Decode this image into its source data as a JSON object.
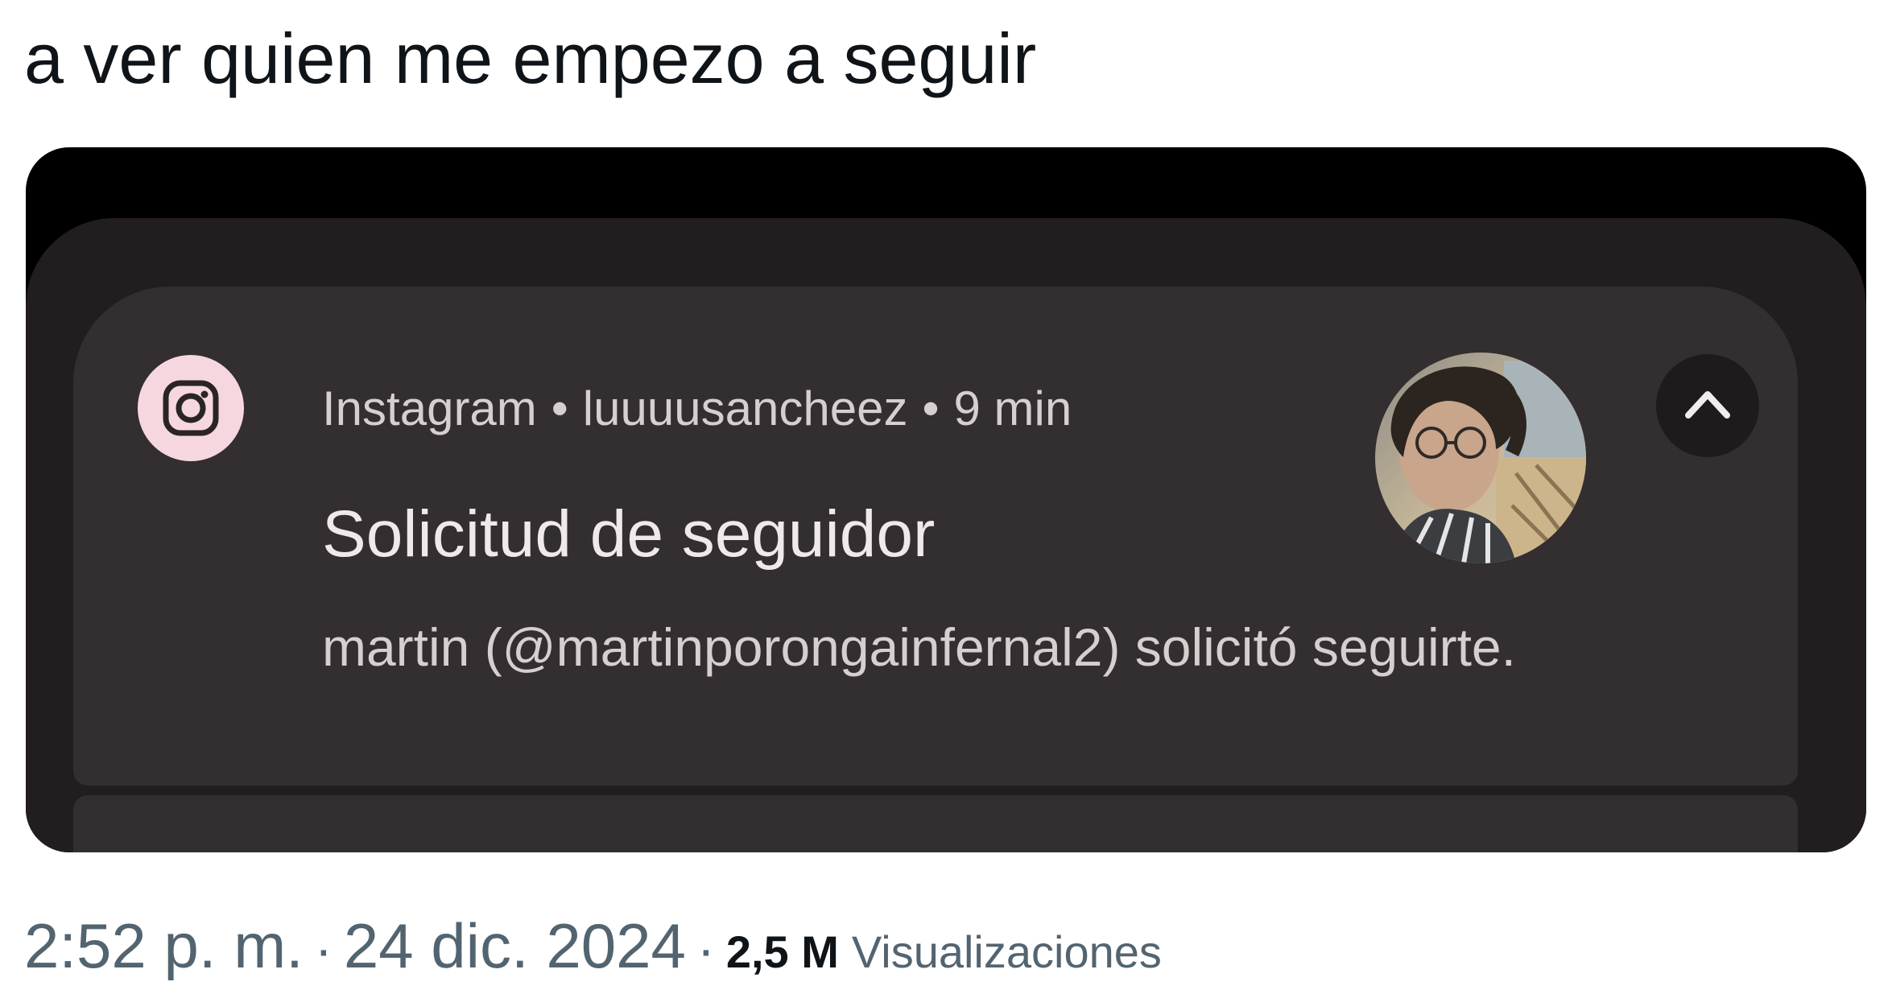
{
  "tweet": {
    "text": "a ver quien me empezo a seguir"
  },
  "notification": {
    "app_icon": "instagram-icon",
    "app_name": "Instagram",
    "separator": "•",
    "account": "luuuusancheez",
    "time_ago": "9 min",
    "title": "Solicitud de seguidor",
    "body": "martin (@martinporongainfernal2) solicitó seguirte.",
    "collapse_icon": "chevron-up-icon"
  },
  "meta": {
    "time": "2:52 p. m.",
    "separator": "·",
    "date": "24 dic. 2024",
    "views_count": "2,5 M",
    "views_label": "Visualizaciones"
  },
  "colors": {
    "shade_background": "#221d1e",
    "card_background": "#332e2f",
    "icon_background": "#f6d7e0",
    "meta_text": "#536471"
  }
}
